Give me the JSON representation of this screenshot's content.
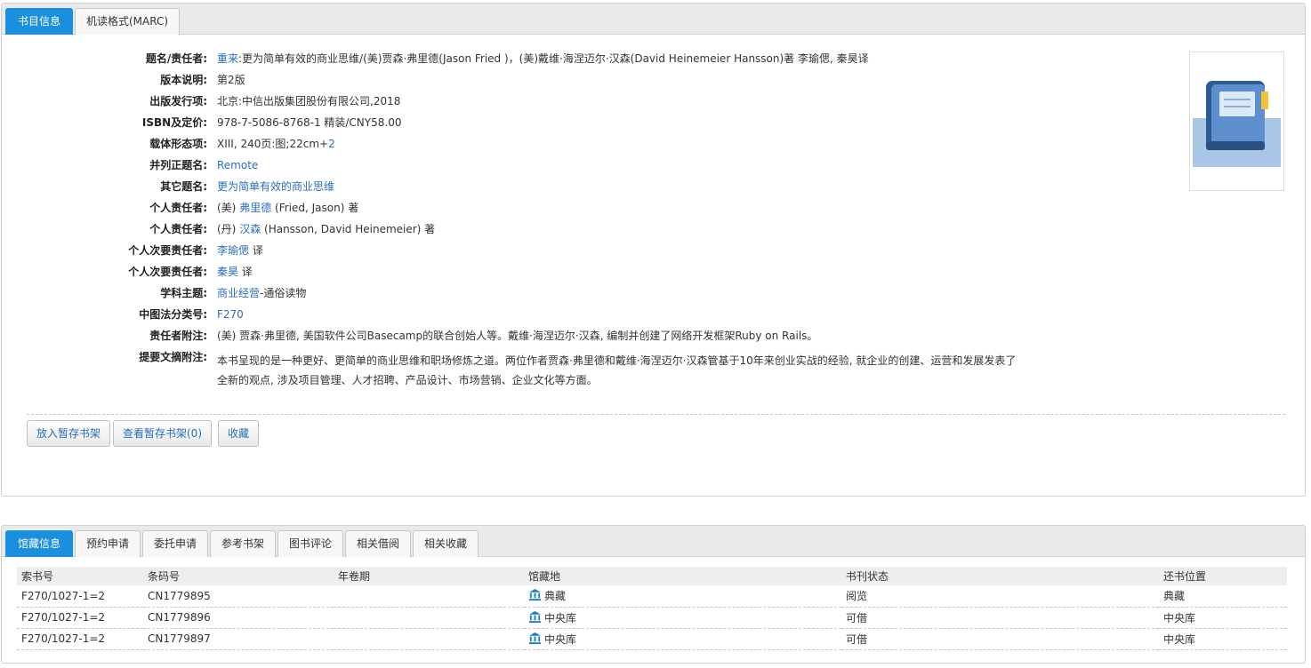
{
  "top_tabs": [
    "书目信息",
    "机读格式(MARC)"
  ],
  "record": {
    "title_resp": {
      "label": "题名/责任者:",
      "link": "重来",
      "text": ":更为简单有效的商业思维/(美)贾森·弗里德(Jason Fried )，(美)戴维·海涅迈尔·汉森(David Heinemeier Hansson)著 李瑜偲, 秦昊译"
    },
    "edition": {
      "label": "版本说明:",
      "value": "第2版"
    },
    "publisher": {
      "label": "出版发行项:",
      "value": "北京:中信出版集团股份有限公司,2018"
    },
    "isbn": {
      "label": "ISBN及定价:",
      "value": "978-7-5086-8768-1 精装/CNY58.00"
    },
    "physical": {
      "label": "载体形态项:",
      "value": "XIII, 240页:图;22cm+",
      "link": "2"
    },
    "parallel_title": {
      "label": "并列正题名:",
      "link": "Remote"
    },
    "other_title": {
      "label": "其它题名:",
      "link": "更为简单有效的商业思维"
    },
    "person1": {
      "label": "个人责任者:",
      "prefix": "(美) ",
      "link": "弗里德",
      "suffix": " (Fried, Jason) 著"
    },
    "person2": {
      "label": "个人责任者:",
      "prefix": "(丹) ",
      "link": "汉森",
      "suffix": " (Hansson, David Heinemeier) 著"
    },
    "secondary1": {
      "label": "个人次要责任者:",
      "link": "李瑜偲",
      "suffix": " 译"
    },
    "secondary2": {
      "label": "个人次要责任者:",
      "link": "秦昊",
      "suffix": " 译"
    },
    "subject": {
      "label": "学科主题:",
      "link": "商业经营",
      "suffix": "-通俗读物"
    },
    "clc": {
      "label": "中图法分类号:",
      "link": "F270"
    },
    "resp_note": {
      "label": "责任者附注:",
      "value": "(美) 贾森·弗里德, 美国软件公司Basecamp的联合创始人等。戴维·海涅迈尔·汉森, 编制并创建了网络开发框架Ruby on Rails。"
    },
    "abstract": {
      "label": "提要文摘附注:",
      "value": "本书呈现的是一种更好、更简单的商业思维和职场修炼之道。两位作者贾森·弗里德和戴维·海涅迈尔·汉森管基于10年来创业实战的经验, 就企业的创建、运营和发展发表了全新的观点, 涉及项目管理、人才招聘、产品设计、市场营销、企业文化等方面。"
    }
  },
  "buttons": {
    "add_shelf": "放入暂存书架",
    "view_shelf": "查看暂存书架(0)",
    "favorite": "收藏"
  },
  "bottom_tabs": [
    "馆藏信息",
    "预约申请",
    "委托申请",
    "参考书架",
    "图书评论",
    "相关借阅",
    "相关收藏"
  ],
  "holdings": {
    "headers": [
      "索书号",
      "条码号",
      "年卷期",
      "馆藏地",
      "书刊状态",
      "还书位置"
    ],
    "rows": [
      [
        "F270/1027-1=2",
        "CN1779895",
        "",
        "典藏",
        "阅览",
        "典藏"
      ],
      [
        "F270/1027-1=2",
        "CN1779896",
        "",
        "中央库",
        "可借",
        "中央库"
      ],
      [
        "F270/1027-1=2",
        "CN1779897",
        "",
        "中央库",
        "可借",
        "中央库"
      ]
    ]
  },
  "icons": {
    "cover": "book-cover-icon",
    "library": "library-building-icon"
  },
  "colors": {
    "active_tab": "#1a8fdd",
    "link": "#2a6ebb",
    "available": "#3a8a2a"
  }
}
